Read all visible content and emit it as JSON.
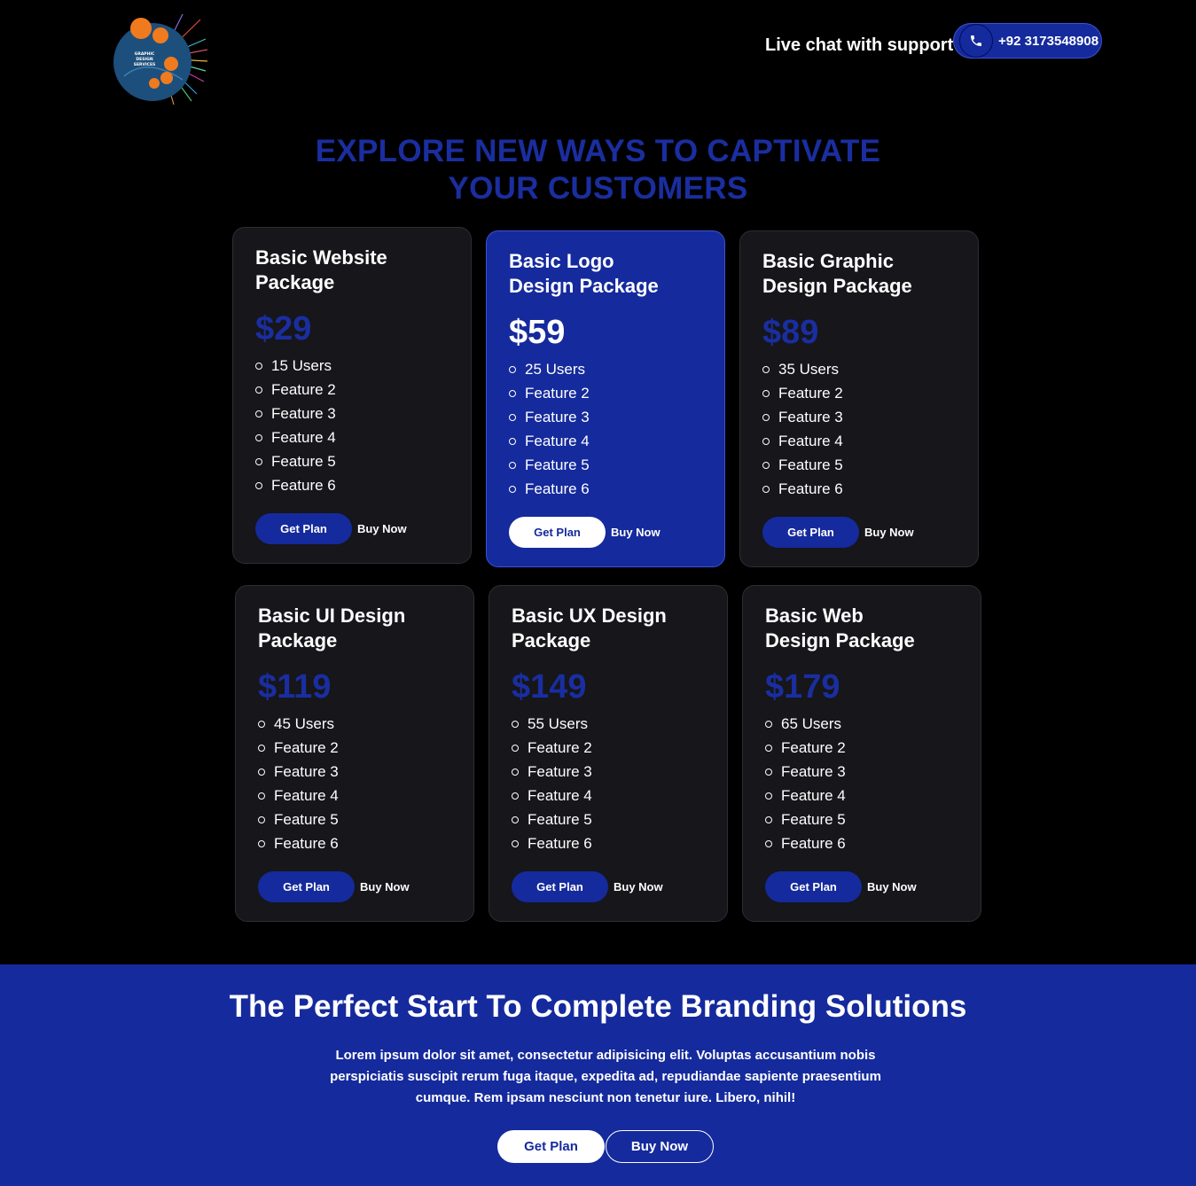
{
  "header": {
    "logo_icon": "graphic-design-services-logo",
    "logo_text": "GRAPHIC DESIGN SERVICES",
    "support_label": "Live chat with support",
    "phone_icon": "phone-icon",
    "phone_number": "+92 3173548908"
  },
  "hero": {
    "headline_line1": "EXPLORE NEW WAYS TO CAPTIVATE",
    "headline_line2": "YOUR CUSTOMERS"
  },
  "plans": [
    {
      "title_line1": "Basic Website",
      "title_line2": "Package",
      "price": "$29",
      "features": [
        "15 Users",
        "Feature 2",
        "Feature 3",
        "Feature 4",
        "Feature 5",
        "Feature 6"
      ],
      "get_label": "Get Plan",
      "buy_label": "Buy Now",
      "highlighted": false
    },
    {
      "title_line1": "Basic Logo",
      "title_line2": "Design Package",
      "price": "$59",
      "features": [
        "25 Users",
        "Feature 2",
        "Feature 3",
        "Feature 4",
        "Feature 5",
        "Feature 6"
      ],
      "get_label": "Get Plan",
      "buy_label": "Buy Now",
      "highlighted": true
    },
    {
      "title_line1": "Basic Graphic",
      "title_line2": "Design Package",
      "price": "$89",
      "features": [
        "35 Users",
        "Feature 2",
        "Feature 3",
        "Feature 4",
        "Feature 5",
        "Feature 6"
      ],
      "get_label": "Get Plan",
      "buy_label": "Buy Now",
      "highlighted": false
    },
    {
      "title_line1": "Basic UI Design",
      "title_line2": "Package",
      "price": "$119",
      "features": [
        "45 Users",
        "Feature 2",
        "Feature 3",
        "Feature 4",
        "Feature 5",
        "Feature 6"
      ],
      "get_label": "Get Plan",
      "buy_label": "Buy Now",
      "highlighted": false
    },
    {
      "title_line1": "Basic UX Design",
      "title_line2": "Package",
      "price": "$149",
      "features": [
        "55 Users",
        "Feature 2",
        "Feature 3",
        "Feature 4",
        "Feature 5",
        "Feature 6"
      ],
      "get_label": "Get Plan",
      "buy_label": "Buy Now",
      "highlighted": false
    },
    {
      "title_line1": "Basic Web",
      "title_line2": "Design Package",
      "price": "$179",
      "features": [
        "65 Users",
        "Feature 2",
        "Feature 3",
        "Feature 4",
        "Feature 5",
        "Feature 6"
      ],
      "get_label": "Get Plan",
      "buy_label": "Buy Now",
      "highlighted": false
    }
  ],
  "footer": {
    "title": "The Perfect Start To Complete Branding Solutions",
    "text": "Lorem ipsum dolor sit amet, consectetur adipisicing elit. Voluptas accusantium nobis perspiciatis suscipit rerum fuga itaque, expedita ad, repudiandae sapiente praesentium cumque. Rem ipsam nesciunt non tenetur iure. Libero, nihil!",
    "get_label": "Get Plan",
    "buy_label": "Buy Now"
  },
  "colors": {
    "accent": "#152a9c",
    "headline": "#1a2ea0",
    "card_bg": "#16161b",
    "logo_circle": "#1d4f7c",
    "logo_bubble": "#f07b1e"
  }
}
